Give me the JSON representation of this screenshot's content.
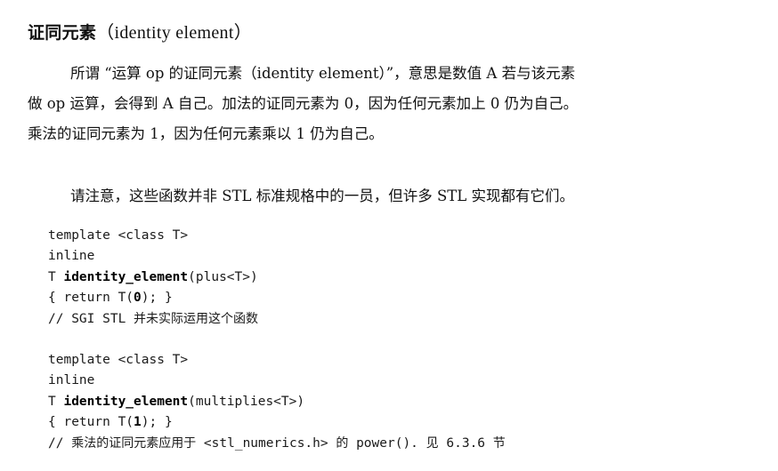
{
  "heading": {
    "cjk": "证同元素",
    "latin": "（identity element）"
  },
  "paragraph1": {
    "line1": "所谓 “运算 op 的证同元素（identity element）”，意思是数值 A 若与该元素",
    "line2": "做 op 运算，会得到 A 自己。加法的证同元素为 0，因为任何元素加上 0 仍为自己。",
    "line3": "乘法的证同元素为 1，因为任何元素乘以 1 仍为自己。"
  },
  "paragraph2": {
    "line1": "请注意，这些函数并非 STL 标准规格中的一员，但许多 STL 实现都有它们。"
  },
  "code1": {
    "l1": "template <class T>",
    "l2": "inline",
    "l3_prefix": "T ",
    "l3_name": "identity_element",
    "l3_suffix": "(plus<T>)",
    "l4_a": "{ return T(",
    "l4_b": "0",
    "l4_c": "); }",
    "l5_a": "// SGI STL ",
    "l5_b": "并未实际运用这个函数"
  },
  "code2": {
    "l1": "template <class T>",
    "l2": "inline",
    "l3_prefix": "T ",
    "l3_name": "identity_element",
    "l3_suffix": "(multiplies<T>)",
    "l4_a": "{ return T(",
    "l4_b": "1",
    "l4_c": "); }",
    "l5_a": "// ",
    "l5_b": "乘法的证同元素应用于",
    "l5_c": " <stl_numerics.h> ",
    "l5_d": "的",
    "l5_e": " power(). ",
    "l5_f": "见",
    "l5_g": " 6.3.6 ",
    "l5_h": "节"
  }
}
